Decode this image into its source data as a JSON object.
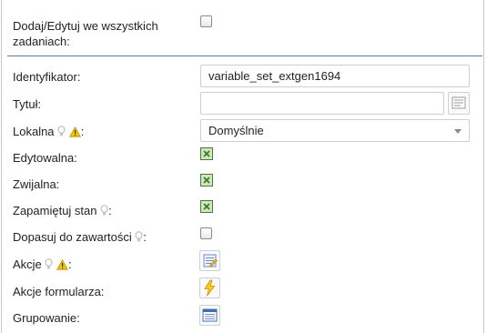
{
  "top": {
    "add_edit_all_label": "Dodaj/Edytuj we wszystkich zadaniach:",
    "add_edit_all_checked": false
  },
  "fields": {
    "identifier": {
      "label": "Identyfikator:",
      "value": "variable_set_extgen1694"
    },
    "title": {
      "label": "Tytuł:",
      "value": "",
      "button_icon": "text-edit-icon"
    },
    "local": {
      "label": "Lokalna",
      "suffix": ":",
      "value": "Domyślnie",
      "icons": [
        "lightbulb-icon",
        "warning-icon"
      ]
    },
    "editable": {
      "label": "Edytowalna:",
      "checked": true
    },
    "collapsible": {
      "label": "Zwijalna:",
      "checked": true
    },
    "remember_state": {
      "label": "Zapamiętuj stan",
      "suffix": ":",
      "checked": true,
      "icons": [
        "lightbulb-icon"
      ]
    },
    "fit_content": {
      "label": "Dopasuj do zawartości",
      "suffix": ":",
      "checked": false,
      "icons": [
        "lightbulb-icon"
      ]
    },
    "actions": {
      "label": "Akcje",
      "suffix": ":",
      "button_icon": "edit-list-icon",
      "icons": [
        "lightbulb-icon",
        "warning-icon"
      ]
    },
    "form_actions": {
      "label": "Akcje formularza:",
      "button_icon": "lightning-icon"
    },
    "grouping": {
      "label": "Grupowanie:",
      "button_icon": "window-list-icon"
    }
  },
  "colors": {
    "divider": "#5b7ea5",
    "checked_fill": "#cfe6bf",
    "checked_mark": "#3c7a2a",
    "warning": "#f5c400"
  }
}
